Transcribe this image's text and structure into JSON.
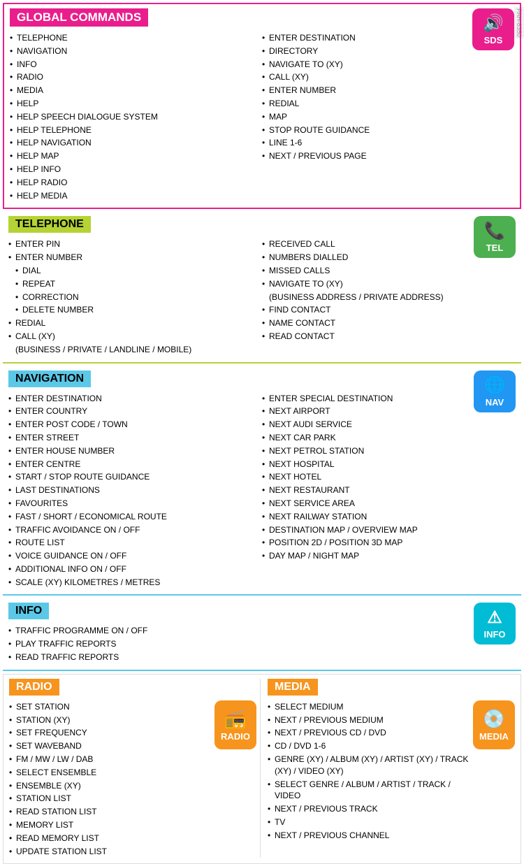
{
  "docId": "PAH-8350",
  "global": {
    "title": "GLOBAL COMMANDS",
    "col1": [
      "TELEPHONE",
      "NAVIGATION",
      "INFO",
      "RADIO",
      "MEDIA",
      "HELP",
      "HELP SPEECH DIALOGUE SYSTEM",
      "HELP TELEPHONE",
      "HELP NAVIGATION",
      "HELP MAP",
      "HELP INFO",
      "HELP RADIO",
      "HELP MEDIA"
    ],
    "col2": [
      "ENTER DESTINATION",
      "DIRECTORY",
      "NAVIGATE TO (XY)",
      "CALL (XY)",
      "ENTER NUMBER",
      "REDIAL",
      "MAP",
      "STOP ROUTE GUIDANCE",
      "LINE 1-6",
      "NEXT / PREVIOUS PAGE"
    ],
    "badge": "SDS",
    "badge_icon": "🔊"
  },
  "telephone": {
    "title": "TELEPHONE",
    "col1": [
      "ENTER PIN",
      "ENTER NUMBER",
      "DIAL",
      "REPEAT",
      "CORRECTION",
      "DELETE NUMBER",
      "REDIAL",
      "CALL (XY)",
      "(BUSINESS / PRIVATE /  LANDLINE / MOBILE)"
    ],
    "col2": [
      "RECEIVED CALL",
      "NUMBERS DIALLED",
      "MISSED CALLS",
      "NAVIGATE TO  (XY)",
      "(BUSINESS ADDRESS / PRIVATE ADDRESS)",
      "FIND CONTACT",
      "NAME CONTACT",
      "READ CONTACT"
    ],
    "badge": "TEL",
    "badge_icon": "📞"
  },
  "navigation": {
    "title": "NAVIGATION",
    "col1": [
      "ENTER DESTINATION",
      "ENTER COUNTRY",
      "ENTER POST CODE / TOWN",
      "ENTER STREET",
      "ENTER HOUSE NUMBER",
      "ENTER CENTRE",
      "START / STOP ROUTE GUIDANCE",
      "LAST DESTINATIONS",
      "FAVOURITES",
      "FAST / SHORT / ECONOMICAL ROUTE",
      "TRAFFIC AVOIDANCE ON / OFF",
      "ROUTE LIST",
      "VOICE GUIDANCE ON / OFF",
      "ADDITIONAL INFO ON / OFF",
      "SCALE  (XY) KILOMETRES / METRES"
    ],
    "col2": [
      "ENTER SPECIAL DESTINATION",
      "NEXT AIRPORT",
      "NEXT AUDI SERVICE",
      "NEXT CAR PARK",
      "NEXT PETROL STATION",
      "NEXT HOSPITAL",
      "NEXT HOTEL",
      "NEXT RESTAURANT",
      "NEXT SERVICE AREA",
      "NEXT RAILWAY STATION",
      "DESTINATION MAP / OVERVIEW MAP",
      "POSITION 2D / POSITION 3D MAP",
      "DAY MAP / NIGHT MAP"
    ],
    "badge": "NAV",
    "badge_icon": "🌐"
  },
  "info": {
    "title": "INFO",
    "items": [
      "TRAFFIC PROGRAMME ON / OFF",
      "PLAY TRAFFIC REPORTS",
      "READ TRAFFIC REPORTS"
    ],
    "badge": "INFO",
    "badge_icon": "⚠"
  },
  "radio": {
    "title": "RADIO",
    "items": [
      "SET STATION",
      "STATION (XY)",
      "SET FREQUENCY",
      "SET WAVEBAND",
      "FM / MW / LW / DAB",
      "SELECT ENSEMBLE",
      "ENSEMBLE (XY)",
      "STATION LIST",
      "READ STATION LIST",
      "MEMORY LIST",
      "READ MEMORY LIST",
      "UPDATE STATION LIST"
    ],
    "badge": "RADIO",
    "badge_icon": "📻"
  },
  "media": {
    "title": "MEDIA",
    "items": [
      "SELECT MEDIUM",
      "NEXT / PREVIOUS MEDIUM",
      "NEXT / PREVIOUS CD / DVD",
      "CD / DVD 1-6",
      "GENRE (XY) / ALBUM (XY) / ARTIST (XY) / TRACK (XY) / VIDEO (XY)",
      "SELECT GENRE / ALBUM / ARTIST  / TRACK / VIDEO",
      "NEXT / PREVIOUS TRACK",
      "TV",
      "NEXT / PREVIOUS CHANNEL"
    ],
    "badge": "MEDIA",
    "badge_icon": "💿"
  }
}
